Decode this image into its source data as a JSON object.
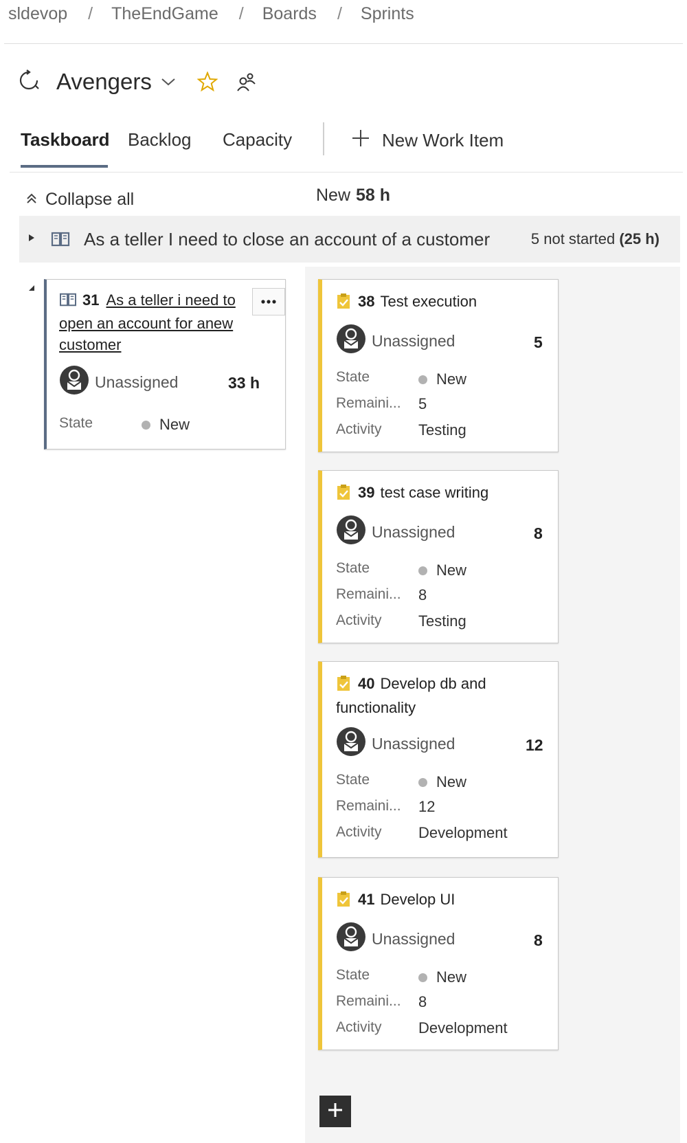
{
  "breadcrumb": [
    "sldevop",
    "TheEndGame",
    "Boards",
    "Sprints"
  ],
  "team": {
    "name": "Avengers"
  },
  "tabs": {
    "taskboard": "Taskboard",
    "backlog": "Backlog",
    "capacity": "Capacity",
    "new_work_item": "New Work Item"
  },
  "collapse_all": "Collapse all",
  "column": {
    "name": "New",
    "hours": "58 h"
  },
  "story_row": {
    "title": "As a teller I need to close an account of a customer",
    "summary": "5 not started",
    "summary_hours": "(25 h)"
  },
  "pbi": {
    "id": "31",
    "title": "As a teller i need to open an account for anew customer",
    "assignee": "Unassigned",
    "hours": "33 h",
    "state_label": "State",
    "state": "New"
  },
  "field_labels": {
    "state": "State",
    "remaining": "Remaini...",
    "activity": "Activity"
  },
  "tasks": [
    {
      "id": "38",
      "title": "Test execution",
      "assignee": "Unassigned",
      "remaining": "5",
      "state": "New",
      "activity": "Testing"
    },
    {
      "id": "39",
      "title": "test case writing",
      "assignee": "Unassigned",
      "remaining": "8",
      "state": "New",
      "activity": "Testing"
    },
    {
      "id": "40",
      "title": "Develop db and functionality",
      "assignee": "Unassigned",
      "remaining": "12",
      "state": "New",
      "activity": "Development"
    },
    {
      "id": "41",
      "title": "Develop UI",
      "assignee": "Unassigned",
      "remaining": "8",
      "state": "New",
      "activity": "Development"
    }
  ],
  "colors": {
    "task_accent": "#efc53a",
    "pbi_accent": "#5b6c84",
    "lane_bg": "#f4f4f4"
  },
  "icons": [
    "sprint-icon",
    "chevron-down-icon",
    "star-icon",
    "people-icon",
    "plus-icon",
    "collapse-icon",
    "expand-triangle-icon",
    "book-icon",
    "more-icon",
    "avatar-icon",
    "task-clipboard-icon",
    "add-icon"
  ]
}
